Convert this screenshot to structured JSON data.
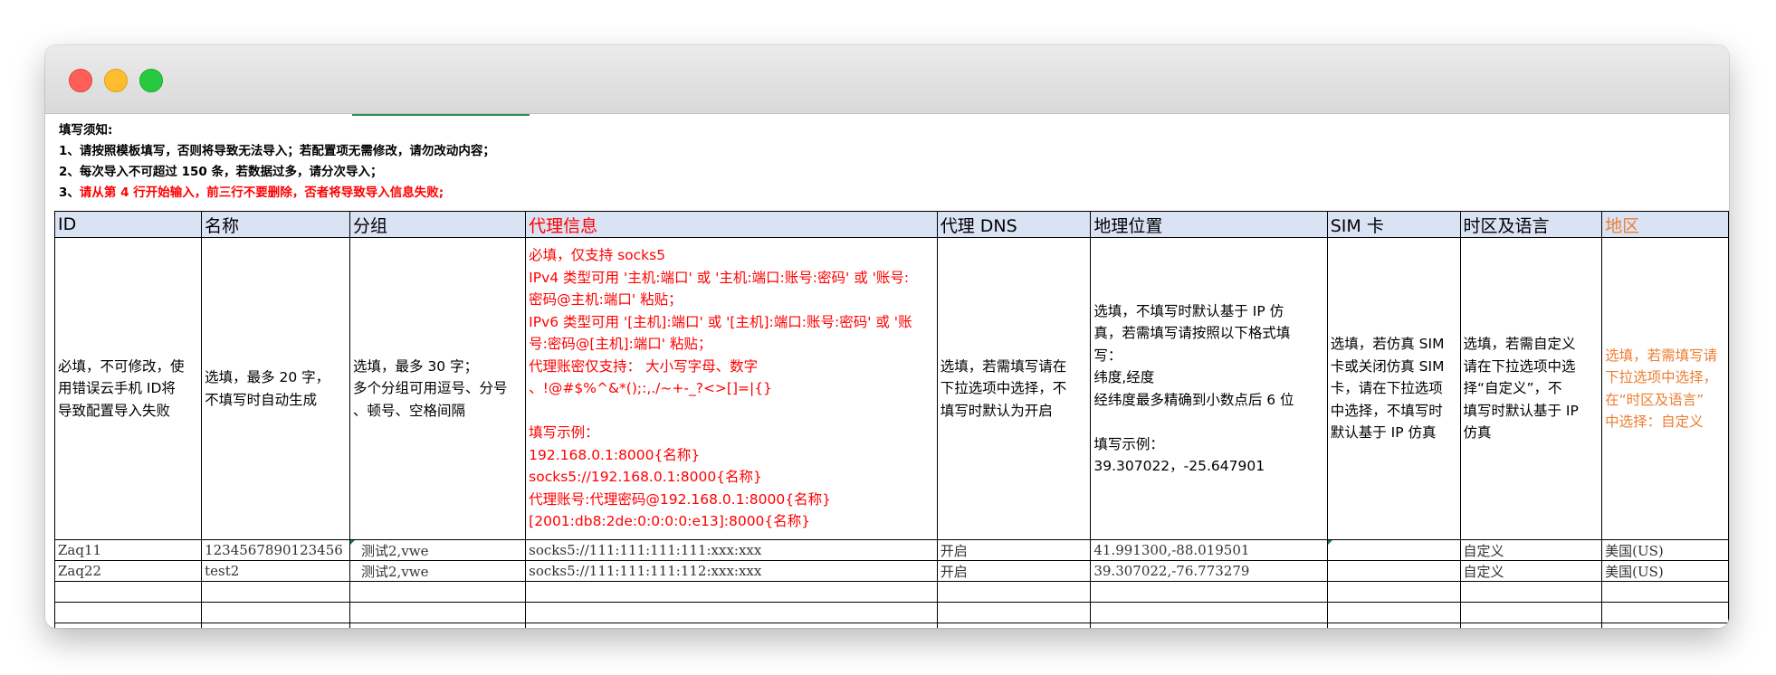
{
  "notes": [
    {
      "text": "填写须知:",
      "red": false
    },
    {
      "text": "1、请按照模板填写，否则将导致无法导入；若配置项无需修改，请勿改动内容；",
      "red": false
    },
    {
      "text": "2、每次导入不可超过 150 条，若数据过多，请分次导入；",
      "red": false
    }
  ],
  "note3_prefix": "3、",
  "note3_red": "请从第 4 行开始输入，前三行不要删除，否者将导致导入信息失败;",
  "headers": [
    "ID",
    "名称",
    "分组",
    "代理信息",
    "代理 DNS",
    "地理位置",
    "SIM 卡",
    "时区及语言",
    "地区"
  ],
  "desc": {
    "id": [
      "必填，不可修改，使",
      "用错误云手机 ID将",
      "导致配置导入失败"
    ],
    "name": [
      "选填，最多 20 字，",
      "不填写时自动生成"
    ],
    "group": [
      "选填，最多 30 字；",
      "多个分组可用逗号、分号",
      "、顿号、空格间隔"
    ],
    "proxy": [
      "必填，仅支持 socks5",
      "IPv4 类型可用 '主机:端口' 或 '主机:端口:账号:密码' 或 '账号:",
      "密码@主机:端口' 粘贴；",
      "IPv6 类型可用 '[主机]:端口' 或 '[主机]:端口:账号:密码' 或 '账",
      "号:密码@[主机]:端口' 粘贴；",
      "代理账密仅支持：  大小写字母、数字",
      "、!@#$%^&*();:,./~+-_?<>[]=|{}",
      "",
      "填写示例：",
      "192.168.0.1:8000{名称}",
      "socks5://192.168.0.1:8000{名称}",
      "代理账号:代理密码@192.168.0.1:8000{名称}",
      "[2001:db8:2de:0:0:0:0:e13]:8000{名称}"
    ],
    "dns": [
      "选填，若需填写请在",
      "下拉选项中选择，不",
      "填写时默认为开启"
    ],
    "geo": [
      "选填，不填写时默认基于 IP 仿",
      "真，若需填写请按照以下格式填",
      "写：",
      "纬度,经度",
      "经纬度最多精确到小数点后 6 位",
      "",
      "填写示例：",
      "39.307022，-25.647901"
    ],
    "sim": [
      "选填，若仿真 SIM",
      "卡或关闭仿真 SIM",
      "卡，请在下拉选项",
      "中选择，不填写时",
      "默认基于 IP 仿真"
    ],
    "tz": [
      "选填，若需自定义",
      "请在下拉选项中选",
      "择“自定义”，不",
      "填写时默认基于 IP",
      "仿真"
    ],
    "region": [
      "选填，若需填写请",
      "下拉选项中选择，",
      "在“时区及语言”",
      "中选择：自定义"
    ]
  },
  "rows": [
    [
      "Zaq11",
      "1234567890123456",
      "测试2,vwe",
      "socks5://111:111:111:111:xxx:xxx",
      "开启",
      "41.991300,-88.019501",
      "",
      "自定义",
      "美国(US)"
    ],
    [
      "Zaq22",
      "test2",
      "测试2,vwe",
      "socks5://111:111:111:112:xxx:xxx",
      "开启",
      "39.307022,-76.773279",
      "",
      "自定义",
      "美国(US)"
    ]
  ],
  "colors": {
    "header_bg": "#dae3f3",
    "red": "#ff0000",
    "orange": "#ed7d31"
  }
}
